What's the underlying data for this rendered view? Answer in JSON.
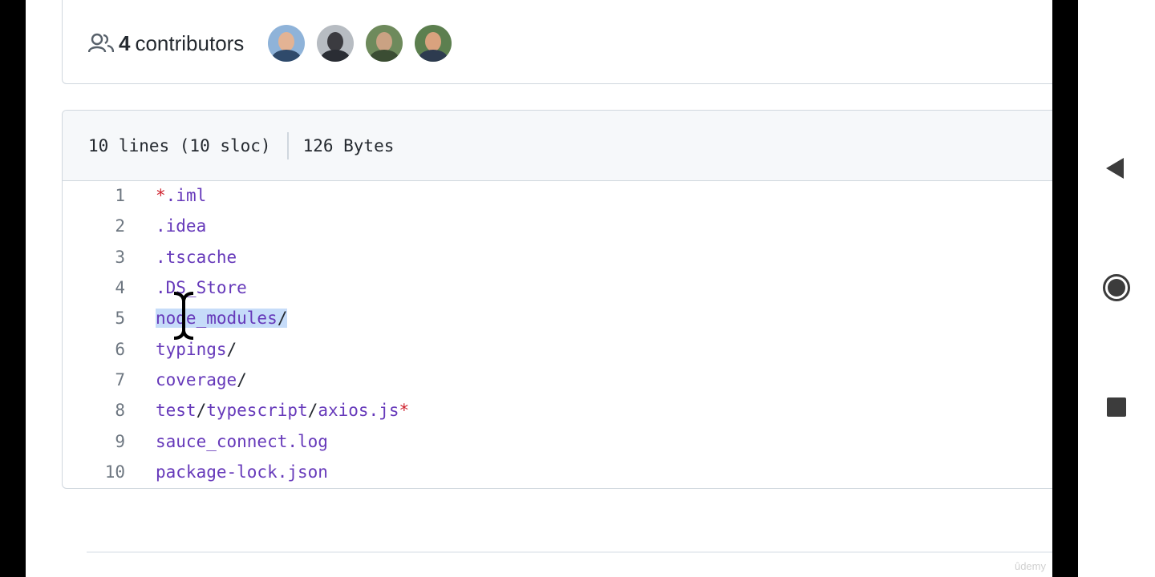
{
  "contributors": {
    "count": "4",
    "label": "contributors",
    "avatars": [
      {
        "name": "avatar-1",
        "bg": "#8fb3d9",
        "face": "#e3b394",
        "body": "#2f4a6b"
      },
      {
        "name": "avatar-2",
        "bg": "#b7bcc2",
        "face": "#3b3b40",
        "body": "#2a2d34"
      },
      {
        "name": "avatar-3",
        "bg": "#6e8a5c",
        "face": "#caa283",
        "body": "#3b4d33"
      },
      {
        "name": "avatar-4",
        "bg": "#5c7f4f",
        "face": "#d9a27e",
        "body": "#2d3b4f"
      }
    ]
  },
  "file": {
    "lines_info": "10 lines (10 sloc)",
    "size": "126 Bytes",
    "code_lines": [
      {
        "num": "1",
        "text": "*.iml"
      },
      {
        "num": "2",
        "text": ".idea"
      },
      {
        "num": "3",
        "text": ".tscache"
      },
      {
        "num": "4",
        "text": ".DS_Store"
      },
      {
        "num": "5",
        "text": "node_modules/"
      },
      {
        "num": "6",
        "text": "typings/"
      },
      {
        "num": "7",
        "text": "coverage/"
      },
      {
        "num": "8",
        "text": "test/typescript/axios.js*"
      },
      {
        "num": "9",
        "text": "sauce_connect.log"
      },
      {
        "num": "10",
        "text": "package-lock.json"
      }
    ],
    "selected_text": "node_modules/"
  },
  "watermark": "ûdemy",
  "navbar": {
    "icons": [
      "back-icon",
      "home-icon",
      "recents-icon"
    ]
  },
  "colors": {
    "code_purple": "#6639ba",
    "code_red": "#cf222e",
    "selection": "#c6dcf9"
  }
}
